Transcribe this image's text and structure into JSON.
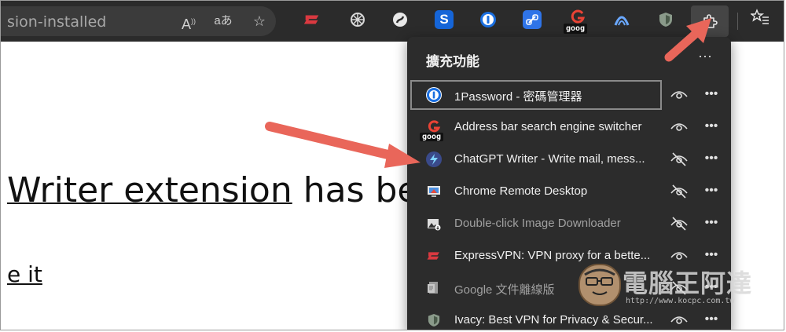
{
  "browser": {
    "url_fragment": "sion-installed",
    "address_icons": [
      "read-aloud-icon",
      "translate-icon",
      "add-favorite-icon"
    ],
    "read_aloud_glyph": "A",
    "translate_glyph": "aあ",
    "toolbar_extensions": [
      {
        "name": "expressvpn-icon",
        "color": "#da3940"
      },
      {
        "name": "chatgpt-icon",
        "color": "#2b2b2b"
      },
      {
        "name": "swirl-icon",
        "color": "#2b2b2b"
      },
      {
        "name": "s-icon",
        "color": "#1565d8",
        "glyph": "S"
      },
      {
        "name": "1password-icon",
        "color": "#1a6fe0"
      },
      {
        "name": "link-icon",
        "color": "#2f74e8"
      },
      {
        "name": "address-bar-search-engine-switcher-icon",
        "color": "#2b2b2b"
      },
      {
        "name": "arch-icon",
        "color": "#2b2b2b"
      },
      {
        "name": "shield-icon",
        "color": "#2b2b2b"
      }
    ],
    "goog_label": "goog"
  },
  "page": {
    "heading_link": "Writer extension",
    "heading_rest": " has be",
    "link_text": "e it"
  },
  "popup": {
    "title": "擴充功能",
    "more_glyph": "···",
    "extensions": [
      {
        "name": "1Password - 密碼管理器",
        "visible": true,
        "enabled": true,
        "icon_color": "#1a6fe0"
      },
      {
        "name": "Address bar search engine switcher",
        "visible": true,
        "enabled": true,
        "icon_color": "#ea4335"
      },
      {
        "name": "ChatGPT Writer - Write mail, mess...",
        "visible": false,
        "enabled": true,
        "icon_color": "#3a4a8a"
      },
      {
        "name": "Chrome Remote Desktop",
        "visible": false,
        "enabled": true,
        "icon_color": "#e8e8e8"
      },
      {
        "name": "Double-click Image Downloader",
        "visible": false,
        "enabled": false,
        "icon_color": "#dddddd"
      },
      {
        "name": "ExpressVPN: VPN proxy for a bette...",
        "visible": true,
        "enabled": true,
        "icon_color": "#da3940"
      },
      {
        "name": "Google 文件離線版",
        "visible": false,
        "enabled": false,
        "icon_color": "#9a9a9a"
      },
      {
        "name": "Ivacy: Best VPN for Privacy & Secur...",
        "visible": true,
        "enabled": true,
        "icon_color": "#6a7a6a"
      }
    ]
  },
  "watermark": {
    "title": "電腦王阿達",
    "url": "http://www.kocpc.com.tw"
  },
  "colors": {
    "arrow": "#e9665a",
    "toolbar_bg": "#2b2b2b",
    "popup_bg": "#2c2c2c"
  }
}
